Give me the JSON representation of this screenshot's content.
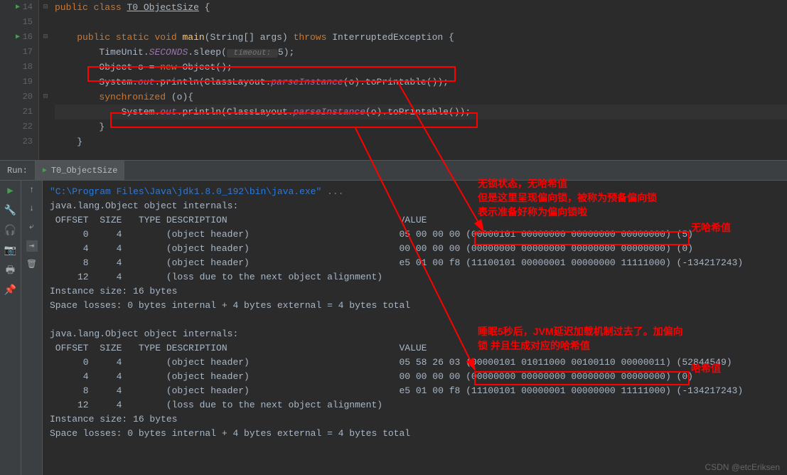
{
  "editor": {
    "lines": [
      {
        "num": "14",
        "run": true
      },
      {
        "num": "15"
      },
      {
        "num": "16",
        "run": true
      },
      {
        "num": "17"
      },
      {
        "num": "18"
      },
      {
        "num": "19"
      },
      {
        "num": "20"
      },
      {
        "num": "21"
      },
      {
        "num": "22"
      },
      {
        "num": "23"
      }
    ],
    "code": {
      "l14_public": "public",
      "l14_class": "class",
      "l14_name": "T0_ObjectSize",
      "l14_brace": " {",
      "l16_public": "public",
      "l16_static": "static",
      "l16_void": "void",
      "l16_main": "main",
      "l16_params": "(String[] args)",
      "l16_throws": "throws",
      "l16_exc": "InterruptedException {",
      "l17_tu": "TimeUnit",
      "l17_sec": "SECONDS",
      "l17_sleep": ".sleep(",
      "l17_hint": " timeout: ",
      "l17_val": "5",
      "l17_end": ");",
      "l18_obj": "Object o = ",
      "l18_new": "new",
      "l18_rest": " Object();",
      "l19_sys": "System.",
      "l19_out": "out",
      "l19_println": ".println",
      "l19_arg": "(ClassLayout.",
      "l19_parse": "parseInstance",
      "l19_rest": "(o).toPrintable());",
      "l20_sync": "synchronized",
      "l20_rest": " (o){",
      "l21_sys": "System.",
      "l21_out": "out",
      "l21_println": ".println",
      "l21_arg": "(ClassLayout.",
      "l21_parse": "parseInstance",
      "l21_rest": "(o).toPrintable())",
      "l22_brace": "}",
      "l23_brace": "}"
    }
  },
  "run": {
    "label": "Run:",
    "tab_name": "T0_ObjectSize"
  },
  "console": {
    "cmd": "\"C:\\Program Files\\Java\\jdk1.8.0_192\\bin\\java.exe\"",
    "cmd_extra": " ...",
    "block1": {
      "header": "java.lang.Object object internals:",
      "cols": " OFFSET  SIZE   TYPE DESCRIPTION                               VALUE",
      "r1": "      0     4        (object header)                           05 00 00 00 (00000101 00000000 00000000 00000000) (5)",
      "r2": "      4     4        (object header)                           00 00 00 00 (00000000 00000000 00000000 00000000) (0)",
      "r3": "      8     4        (object header)                           e5 01 00 f8 (11100101 00000001 00000000 11111000) (-134217243)",
      "r4": "     12     4        (loss due to the next object alignment)",
      "inst": "Instance size: 16 bytes",
      "loss": "Space losses: 0 bytes internal + 4 bytes external = 4 bytes total"
    },
    "block2": {
      "header": "java.lang.Object object internals:",
      "cols": " OFFSET  SIZE   TYPE DESCRIPTION                               VALUE",
      "r1": "      0     4        (object header)                           05 58 26 03 (00000101 01011000 00100110 00000011) (52844549)",
      "r2": "      4     4        (object header)                           00 00 00 00 (00000000 00000000 00000000 00000000) (0)",
      "r3": "      8     4        (object header)                           e5 01 00 f8 (11100101 00000001 00000000 11111000) (-134217243)",
      "r4": "     12     4        (loss due to the next object alignment)",
      "inst": "Instance size: 16 bytes",
      "loss": "Space losses: 0 bytes internal + 4 bytes external = 4 bytes total"
    }
  },
  "annotations": {
    "a1_l1": "无锁状态，无哈希值",
    "a1_l2": "但是这里呈现偏向锁，被称为预备偏向锁",
    "a1_l3": "表示准备好称为偏向锁啦",
    "a2": "无哈希值",
    "a3_l1": "睡眠5秒后，JVM延迟加载机制过去了。加偏向",
    "a3_l2": "锁 并且生成对应的哈希值",
    "a4": "哈希值"
  },
  "watermark": "CSDN @etcEriksen"
}
